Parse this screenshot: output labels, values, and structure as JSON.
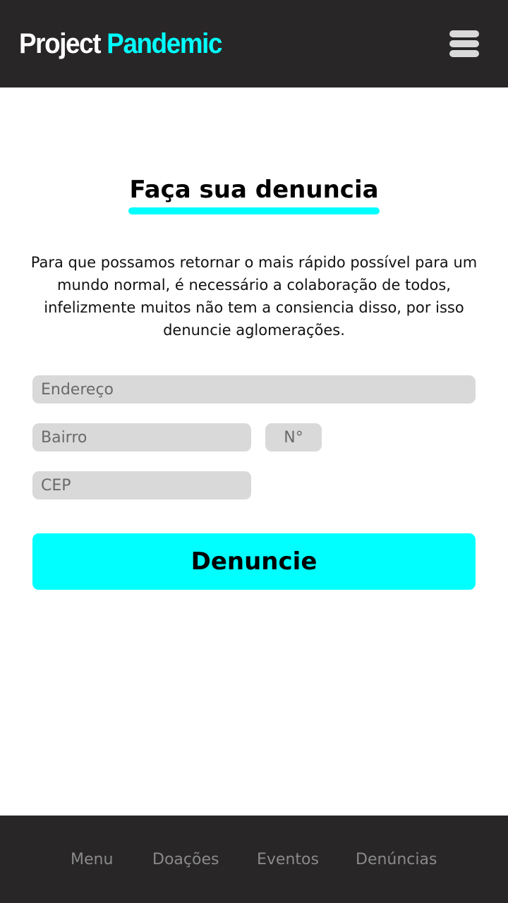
{
  "header": {
    "logo_part1": "Project",
    "logo_part2": "Pandemic",
    "menu_icon": "hamburger-menu-icon"
  },
  "main": {
    "title": "Faça sua denuncia",
    "intro": "Para que possamos retornar o mais rápido possível para um mundo normal, é necessário a colaboração de todos, infelizmente muitos não tem a consiencia disso, por isso denuncie aglomerações.",
    "form": {
      "endereco_placeholder": "Endereço",
      "bairro_placeholder": "Bairro",
      "numero_placeholder": "N°",
      "cep_placeholder": "CEP",
      "submit_label": "Denuncie"
    }
  },
  "footer": {
    "nav": [
      "Menu",
      "Doações",
      "Eventos",
      "Denúncias"
    ]
  },
  "colors": {
    "accent": "#00ffff",
    "bar_background": "#282627",
    "field_background": "#d9d9d9"
  }
}
